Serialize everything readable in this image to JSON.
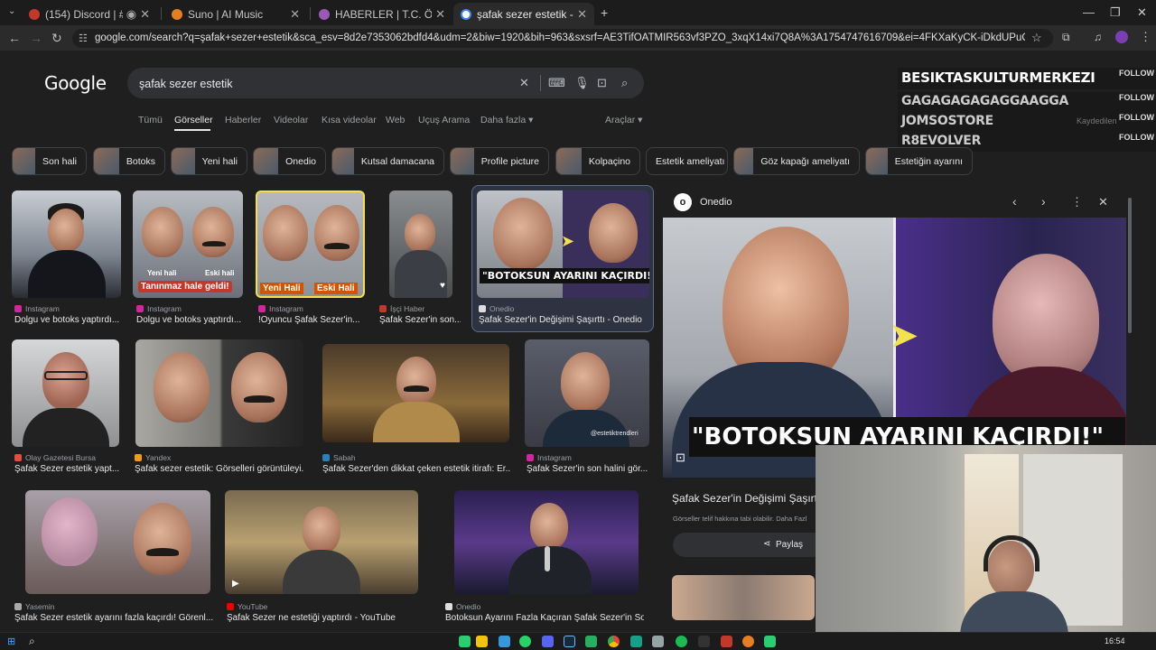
{
  "browser": {
    "tabs": [
      {
        "label": "(154) Discord | # ... chat | ...",
        "active": false
      },
      {
        "label": "Suno | AI Music",
        "active": false
      },
      {
        "label": "HABERLER | T.C. Ödemiş Beledi...",
        "active": false
      },
      {
        "label": "şafak sezer estetik - Google'da...",
        "active": true
      }
    ],
    "new_tab": "+",
    "url": "google.com/search?q=şafak+sezer+estetik&sca_esv=8d2e7353062bdfd4&udm=2&biw=1920&bih=963&sxsrf=AE3TifOATMIR563vf3PZO_3xqX14xi7Q8A%3A1754747616709&ei=4FKXaKyCK-iDkdUPuOWQmAQ&oq=şafak+&gs_lp=EgNpbWciB8WYYWZ..."
  },
  "google": {
    "logo": "Google",
    "query": "şafak sezer estetik",
    "tabs": [
      "Tümü",
      "Görseller",
      "Haberler",
      "Videolar",
      "Kısa videolar",
      "Web",
      "Uçuş Arama",
      "Daha fazla ▾"
    ],
    "active_tab": "Görseller",
    "tools": "Araçlar ▾",
    "chips": [
      "Son hali",
      "Botoks",
      "Yeni hali",
      "Onedio",
      "Kutsal damacana",
      "Profile picture",
      "Kolpaçino",
      "Estetik ameliyatı",
      "Göz kapağı ameliyatı",
      "Estetiğin ayarını"
    ]
  },
  "results": [
    {
      "source": "Instagram",
      "caption": "Dolgu ve botoks yaptırdı..."
    },
    {
      "source": "Instagram",
      "caption": "Dolgu ve botoks yaptırdı...",
      "overlay": [
        "Yeni hali",
        "Eski hali",
        "Tanınmaz hale geldi!"
      ]
    },
    {
      "source": "Instagram",
      "caption": "!Oyuncu Şafak Sezer'in...",
      "overlay": [
        "Yeni Hali",
        "Eski Hali"
      ]
    },
    {
      "source": "İşçi Haber",
      "caption": "Şafak Sezer'in son..."
    },
    {
      "source": "Onedio",
      "caption": "Şafak Sezer'in Değişimi Şaşırttı - Onedio",
      "overlay": [
        "\"BOTOKSUN AYARINI KAÇIRDI!\""
      ]
    },
    {
      "source": "Olay Gazetesi Bursa",
      "caption": "Şafak Sezer estetik yapt..."
    },
    {
      "source": "Yandex",
      "caption": "Şafak sezer estetik: Görselleri görüntüleyi..."
    },
    {
      "source": "Sabah",
      "caption": "Şafak Sezer'den dikkat çeken estetik itirafı: Er..."
    },
    {
      "source": "Instagram",
      "caption": "Şafak Sezer'in son halini gör...",
      "overlay": [
        "@estetiktrendleri"
      ]
    },
    {
      "source": "Yasemin",
      "caption": "Şafak Sezer estetik ayarını fazla kaçırdı! Görenl..."
    },
    {
      "source": "YouTube",
      "caption": "Şafak Sezer ne estetiği yaptırdı - YouTube"
    },
    {
      "source": "Onedio",
      "caption": "Botoksun Ayarını Fazla Kaçıran Şafak Sezer'in So..."
    }
  ],
  "preview": {
    "source": "Onedio",
    "headline": "\"BOTOKSUN AYARINI KAÇIRDI!\"",
    "title": "Şafak Sezer'in Değişimi Şaşırtt",
    "notice": "Görseller telif hakkına tabi olabilir. Daha Fazl",
    "share": "Paylaş"
  },
  "stream_overlay": [
    {
      "name": "BESIKTASKULTURMERKEZI",
      "action": "FOLLOW"
    },
    {
      "name": "GAGAGAGAGAGGAAGGA",
      "action": "FOLLOW"
    },
    {
      "name": "JOMSOSTORE",
      "action": "FOLLOW",
      "extra": "Kaydedilen"
    },
    {
      "name": "R8EVOLVER",
      "action": "FOLLOW"
    }
  ],
  "taskbar": {
    "time": "16:54"
  },
  "colors": {
    "accent": "#8ab4f8",
    "bg": "#1f1f1f",
    "chip_border": "#3c4043",
    "muted": "#9aa0a6"
  }
}
